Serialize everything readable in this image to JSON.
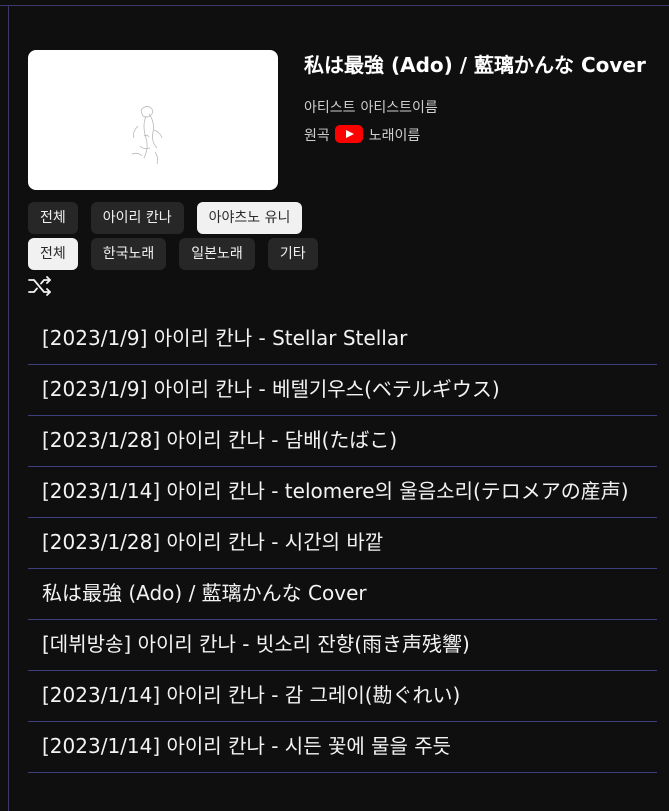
{
  "now_playing": {
    "title": "私は最強 (Ado) / 藍璃かんな Cover",
    "artist_label": "아티스트",
    "artist_name": "아티스트이름",
    "original_label": "원곡",
    "song_name": "노래이름",
    "youtube_icon": "youtube-icon",
    "youtube_color": "#ff0000"
  },
  "filters": {
    "artists": [
      {
        "label": "전체",
        "active": false
      },
      {
        "label": "아이리 칸나",
        "active": false
      },
      {
        "label": "아야츠노 유니",
        "active": true
      }
    ],
    "categories": [
      {
        "label": "전체",
        "active": true
      },
      {
        "label": "한국노래",
        "active": false
      },
      {
        "label": "일본노래",
        "active": false
      },
      {
        "label": "기타",
        "active": false
      }
    ]
  },
  "controls": {
    "shuffle_icon": "shuffle-icon"
  },
  "playlist": [
    {
      "title": "[2023/1/9] 아이리 칸나 - Stellar Stellar"
    },
    {
      "title": "[2023/1/9] 아이리 칸나 - 베텔기우스(ベテルギウス)"
    },
    {
      "title": "[2023/1/28] 아이리 칸나 - 담배(たばこ)"
    },
    {
      "title": "[2023/1/14] 아이리 칸나 - telomere의 울음소리(テロメアの産声)"
    },
    {
      "title": "[2023/1/28] 아이리 칸나 - 시간의 바깥"
    },
    {
      "title": "私は最強 (Ado) / 藍璃かんな Cover"
    },
    {
      "title": "[데뷔방송] 아이리 칸나 - 빗소리 잔향(雨き声残響)"
    },
    {
      "title": "[2023/1/14] 아이리 칸나 - 감 그레이(勘ぐれい)"
    },
    {
      "title": "[2023/1/14] 아이리 칸나 - 시든 꽃에 물을 주듯"
    }
  ],
  "colors": {
    "background": "#0f0f10",
    "divider": "#3f3f80",
    "chip": "#272727",
    "chip_active": "#f1f1f1"
  }
}
